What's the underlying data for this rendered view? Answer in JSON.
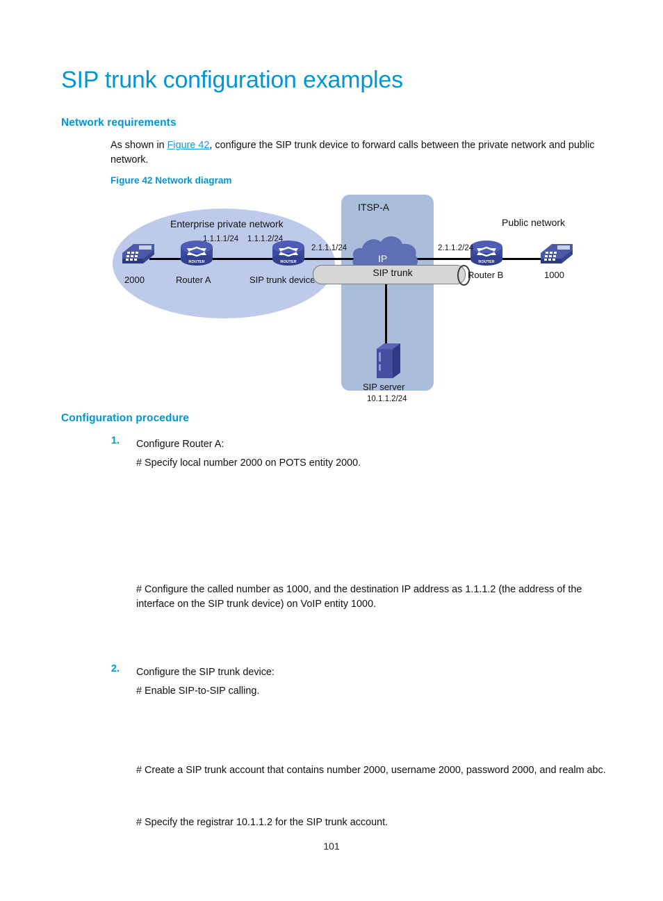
{
  "document": {
    "title": "SIP trunk configuration examples",
    "page_number": "101"
  },
  "sections": {
    "network_requirements": {
      "heading": "Network requirements",
      "paragraph_before_link": "As shown in ",
      "link_text": "Figure 42",
      "paragraph_after_link": ", configure the SIP trunk device to forward calls between the private network and public network."
    },
    "figure": {
      "caption": "Figure 42 Network diagram",
      "zones": {
        "enterprise_private_network": "Enterprise private network",
        "itsp": "ITSP-A",
        "public_network": "Public network"
      },
      "nodes": {
        "phone_left": "2000",
        "router_a": "Router A",
        "sip_trunk_device": "SIP trunk device",
        "ip_cloud": "IP",
        "sip_trunk": "SIP trunk",
        "router_b": "Router B",
        "phone_right": "1000",
        "sip_server": "SIP server",
        "sip_server_address": "10.1.1.2/24"
      },
      "interface_addresses": {
        "router_a_right": "1.1.1.1/24",
        "sip_trunk_left": "1.1.1.2/24",
        "sip_trunk_right": "2.1.1.1/24",
        "router_b_left": "2.1.1.2/24"
      }
    },
    "configuration_procedure": {
      "heading": "Configuration procedure",
      "steps": [
        {
          "number": "1.",
          "title": "Configure Router A:",
          "comments": [
            "# Specify local number 2000 on POTS entity 2000.",
            "# Configure the called number as 1000, and the destination IP address as 1.1.1.2 (the address of the interface on the SIP trunk device) on VoIP entity 1000."
          ]
        },
        {
          "number": "2.",
          "title": "Configure the SIP trunk device:",
          "comments": [
            "# Enable SIP-to-SIP calling.",
            "# Create a SIP trunk account that contains number 2000, username 2000, password 2000, and realm abc.",
            "# Specify the registrar 10.1.1.2 for the SIP trunk account."
          ]
        }
      ]
    }
  },
  "colors": {
    "brand_blue": "#0096d6",
    "link_blue": "#2196d9",
    "zone_ellipse": "#bdcaea",
    "zone_itsp": "#a9bedb",
    "device_blue": "#3b4a9e",
    "cloud_blue": "#5f6fb5",
    "trunk_gray": "#d6d6d6"
  }
}
